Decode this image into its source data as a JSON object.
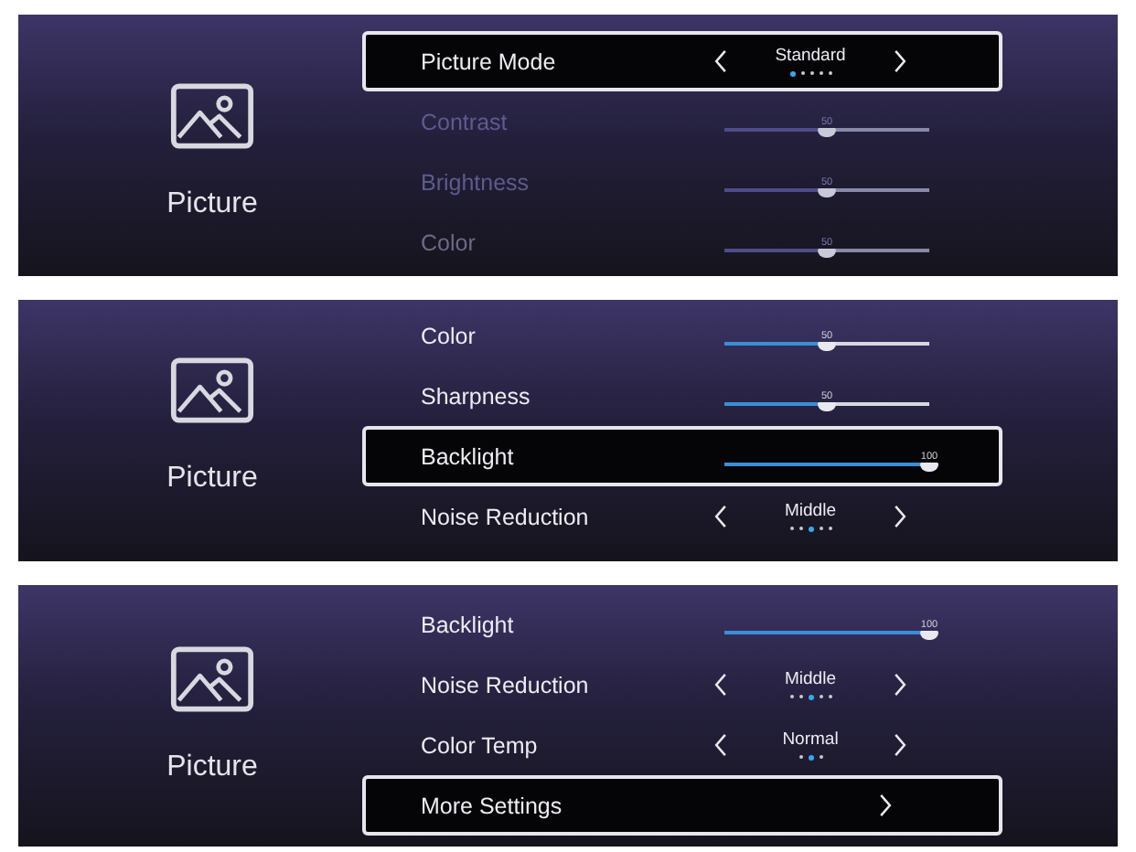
{
  "panels": [
    {
      "category": "Picture",
      "rows": [
        {
          "kind": "choice",
          "label": "Picture Mode",
          "value": "Standard",
          "dots": [
            {
              "selected": true
            },
            {
              "selected": false
            },
            {
              "selected": false
            },
            {
              "selected": false
            },
            {
              "selected": false
            }
          ],
          "selected": true,
          "disabled": false
        },
        {
          "kind": "slider",
          "label": "Contrast",
          "reading": "50",
          "level": 0.5,
          "selected": false,
          "disabled": true
        },
        {
          "kind": "slider",
          "label": "Brightness",
          "reading": "50",
          "level": 0.5,
          "selected": false,
          "disabled": true
        },
        {
          "kind": "slider",
          "label": "Color",
          "reading": "50",
          "level": 0.5,
          "selected": false,
          "disabled": true
        }
      ]
    },
    {
      "category": "Picture",
      "rows": [
        {
          "kind": "slider",
          "label": "Color",
          "reading": "50",
          "level": 0.5,
          "selected": false,
          "disabled": false
        },
        {
          "kind": "slider",
          "label": "Sharpness",
          "reading": "50",
          "level": 0.5,
          "selected": false,
          "disabled": false
        },
        {
          "kind": "slider",
          "label": "Backlight",
          "reading": "100",
          "level": 1,
          "selected": true,
          "disabled": false
        },
        {
          "kind": "choice",
          "label": "Noise Reduction",
          "value": "Middle",
          "dots": [
            {
              "selected": false
            },
            {
              "selected": false
            },
            {
              "selected": true
            },
            {
              "selected": false
            },
            {
              "selected": false
            }
          ],
          "selected": false,
          "disabled": false
        }
      ]
    },
    {
      "category": "Picture",
      "rows": [
        {
          "kind": "slider",
          "label": "Backlight",
          "reading": "100",
          "level": 1,
          "selected": false,
          "disabled": false
        },
        {
          "kind": "choice",
          "label": "Noise Reduction",
          "value": "Middle",
          "dots": [
            {
              "selected": false
            },
            {
              "selected": false
            },
            {
              "selected": true
            },
            {
              "selected": false
            },
            {
              "selected": false
            }
          ],
          "selected": false,
          "disabled": false
        },
        {
          "kind": "choice",
          "label": "Color Temp",
          "value": "Normal",
          "dots": [
            {
              "selected": false
            },
            {
              "selected": true
            },
            {
              "selected": false
            }
          ],
          "selected": false,
          "disabled": false
        },
        {
          "kind": "link",
          "label": "More Settings",
          "selected": true,
          "disabled": false
        }
      ]
    }
  ]
}
